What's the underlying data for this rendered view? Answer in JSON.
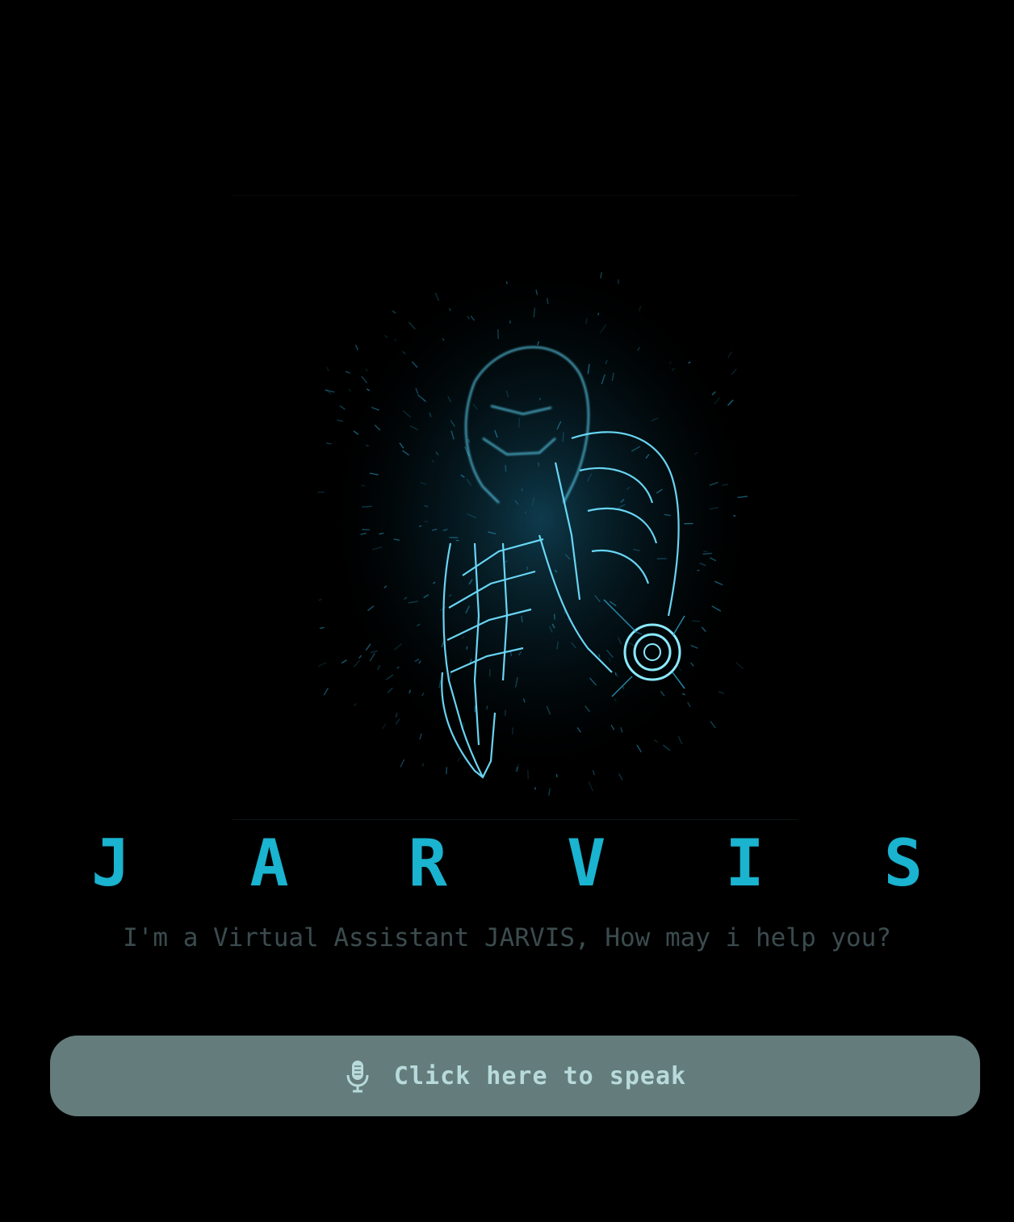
{
  "app": {
    "title": "J A R V I S",
    "subtitle": "I'm a Virtual Assistant JARVIS, How may i help you?"
  },
  "speak_button": {
    "label": "Click here to speak",
    "icon": "microphone-icon"
  },
  "hero": {
    "icon": "iron-man-hologram-image"
  },
  "colors": {
    "background": "#000000",
    "title": "#1ab3d0",
    "subtitle": "#3b4b4e",
    "button_bg": "#647c7c",
    "button_text": "#b8dadb",
    "hologram": "#3ec8f0"
  }
}
